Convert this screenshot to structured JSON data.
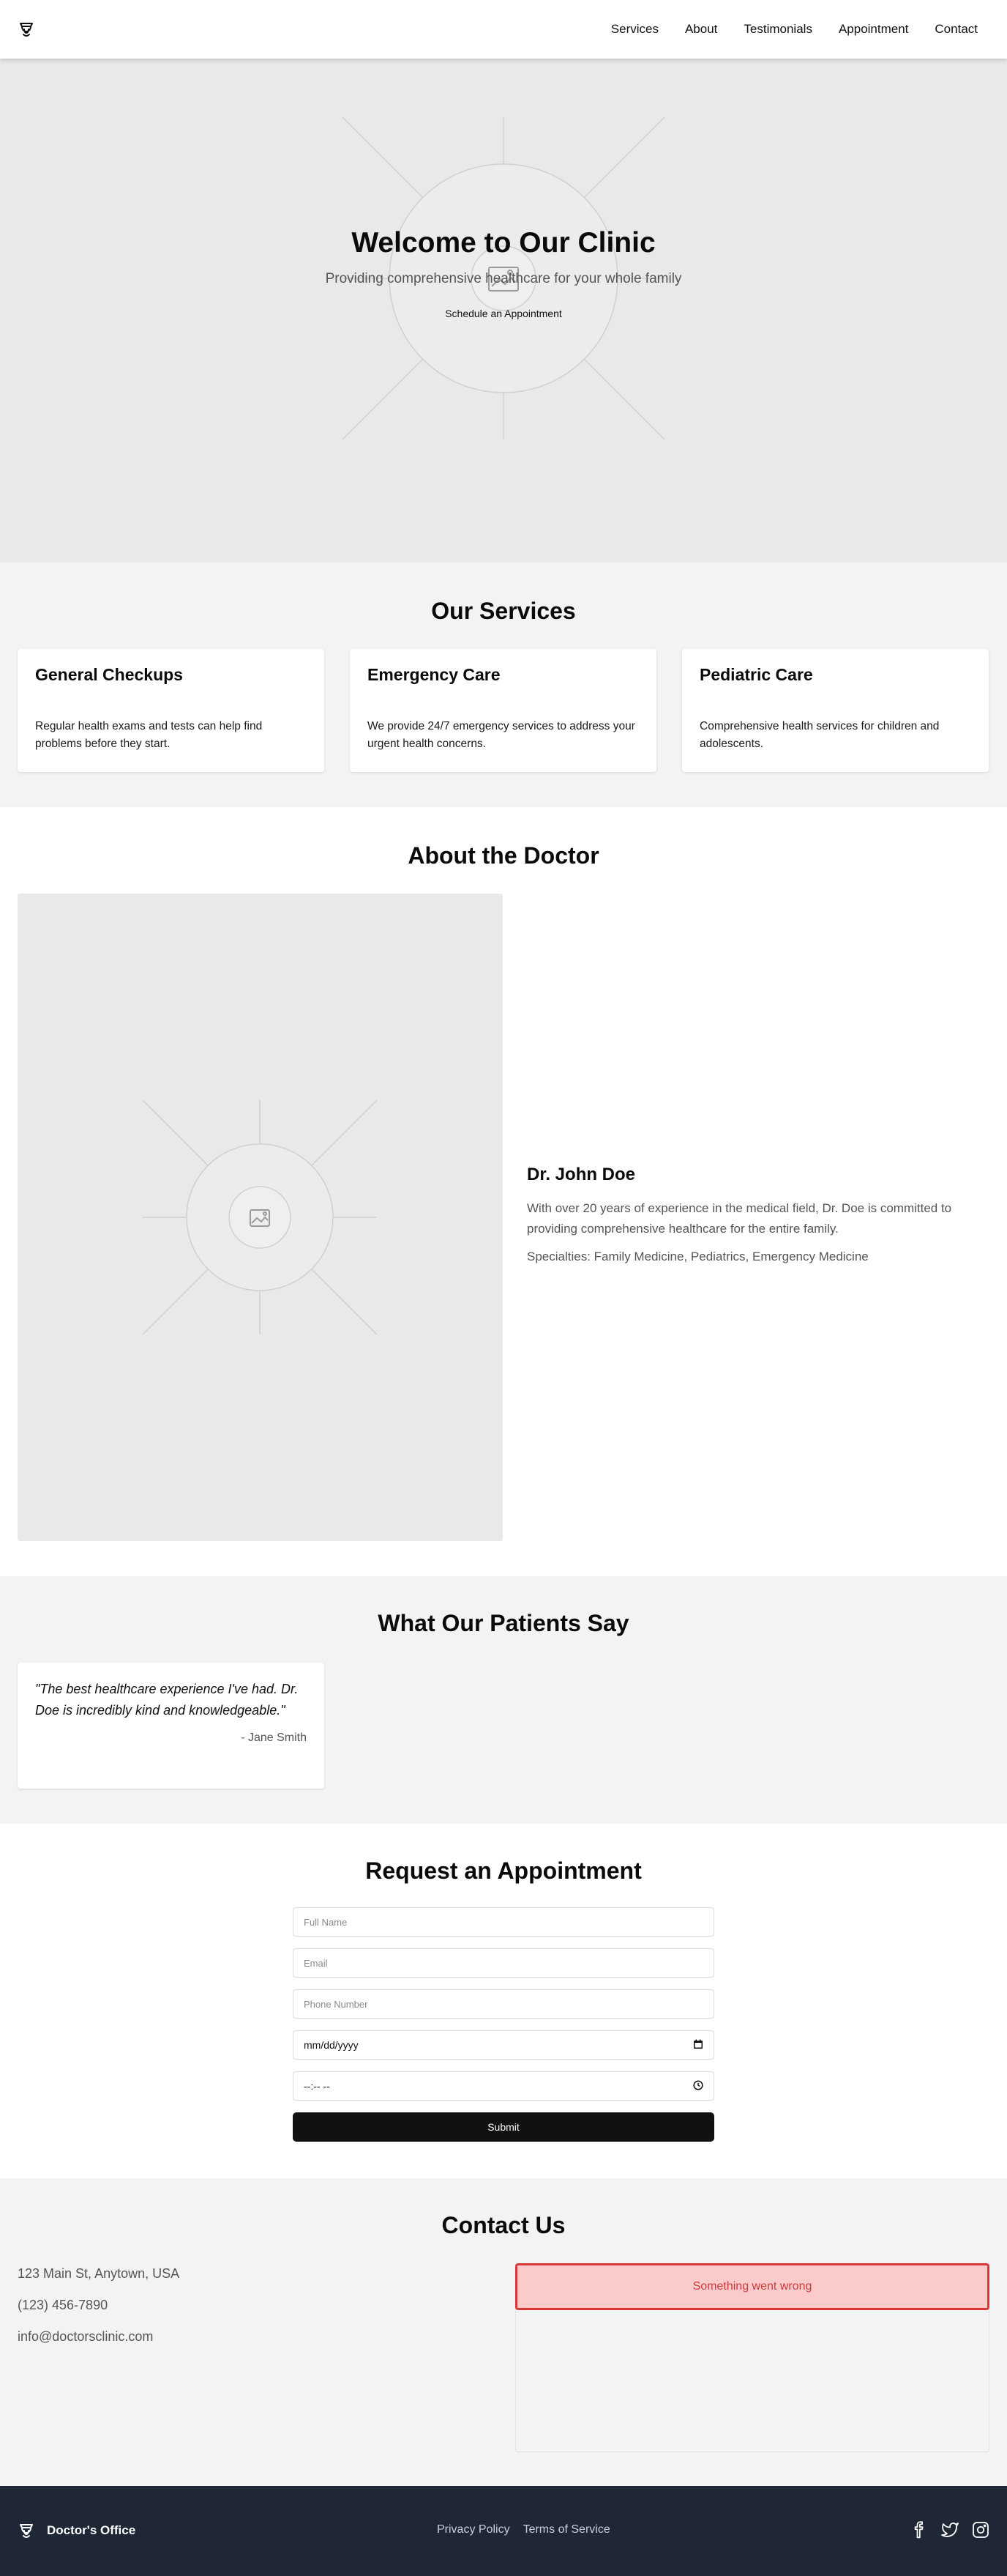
{
  "nav": {
    "items": [
      "Services",
      "About",
      "Testimonials",
      "Appointment",
      "Contact"
    ]
  },
  "hero": {
    "title": "Welcome to Our Clinic",
    "subtitle": "Providing comprehensive healthcare for your whole family",
    "cta": "Schedule an Appointment"
  },
  "services": {
    "title": "Our Services",
    "items": [
      {
        "name": "General Checkups",
        "description": "Regular health exams and tests can help find problems before they start."
      },
      {
        "name": "Emergency Care",
        "description": "We provide 24/7 emergency services to address your urgent health concerns."
      },
      {
        "name": "Pediatric Care",
        "description": "Comprehensive health services for children and adolescents."
      }
    ]
  },
  "about": {
    "title": "About the Doctor",
    "name": "Dr. John Doe",
    "bio": "With over 20 years of experience in the medical field, Dr. Doe is committed to providing comprehensive healthcare for the entire family.",
    "specialties": "Specialties: Family Medicine, Pediatrics, Emergency Medicine"
  },
  "testimonials": {
    "title": "What Our Patients Say",
    "items": [
      {
        "quote": "\"The best healthcare experience I've had. Dr. Doe is incredibly kind and knowledgeable.\"",
        "author": "- Jane Smith"
      }
    ]
  },
  "appointment": {
    "title": "Request an Appointment",
    "fullname_placeholder": "Full Name",
    "email_placeholder": "Email",
    "phone_placeholder": "Phone Number",
    "date_value": "mm/dd/yyyy",
    "time_value": "--:-- --",
    "submit": "Submit"
  },
  "contact": {
    "title": "Contact Us",
    "address": "123 Main St, Anytown, USA",
    "phone": "(123) 456-7890",
    "email": "info@doctorsclinic.com",
    "map_error": "Something went wrong"
  },
  "footer": {
    "brand": "Doctor's Office",
    "links": [
      "Privacy Policy",
      "Terms of Service"
    ],
    "socials": [
      "facebook-icon",
      "twitter-icon",
      "instagram-icon"
    ]
  },
  "colors": {
    "error_bg": "#fbcaca",
    "error_border": "#d93636",
    "footer_bg": "#1f2736",
    "section_alt_bg": "#f2f3f5"
  }
}
